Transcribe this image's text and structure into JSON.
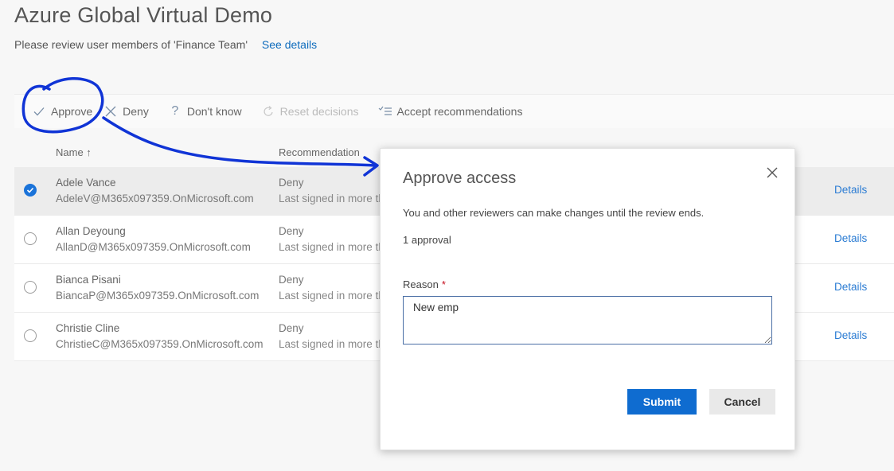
{
  "page": {
    "title": "Azure Global Virtual Demo",
    "subtitle": "Please review user members of 'Finance Team'",
    "see_details": "See details"
  },
  "toolbar": {
    "approve": "Approve",
    "deny": "Deny",
    "dont_know": "Don't know",
    "reset": "Reset decisions",
    "accept": "Accept recommendations"
  },
  "grid": {
    "columns": {
      "name": "Name ↑",
      "recommendation": "Recommendation"
    },
    "rows": [
      {
        "name": "Adele Vance",
        "email": "AdeleV@M365x097359.OnMicrosoft.com",
        "recommendation": "Deny",
        "rec_detail": "Last signed in more than 30 days ago",
        "details": "Details",
        "selected": true
      },
      {
        "name": "Allan Deyoung",
        "email": "AllanD@M365x097359.OnMicrosoft.com",
        "recommendation": "Deny",
        "rec_detail": "Last signed in more than 30 days ago",
        "details": "Details",
        "selected": false
      },
      {
        "name": "Bianca Pisani",
        "email": "BiancaP@M365x097359.OnMicrosoft.com",
        "recommendation": "Deny",
        "rec_detail": "Last signed in more than 30 days ago",
        "details": "Details",
        "selected": false
      },
      {
        "name": "Christie Cline",
        "email": "ChristieC@M365x097359.OnMicrosoft.com",
        "recommendation": "Deny",
        "rec_detail": "Last signed in more than 30 days ago",
        "details": "Details",
        "selected": false
      }
    ]
  },
  "dialog": {
    "title": "Approve access",
    "info": "You and other reviewers can make changes until the review ends.",
    "approval_count": "1 approval",
    "reason_label": "Reason",
    "required_mark": "*",
    "reason_value": "New emp",
    "submit": "Submit",
    "cancel": "Cancel"
  },
  "colors": {
    "accent": "#0f6cd0",
    "annotation": "#1034d6"
  }
}
